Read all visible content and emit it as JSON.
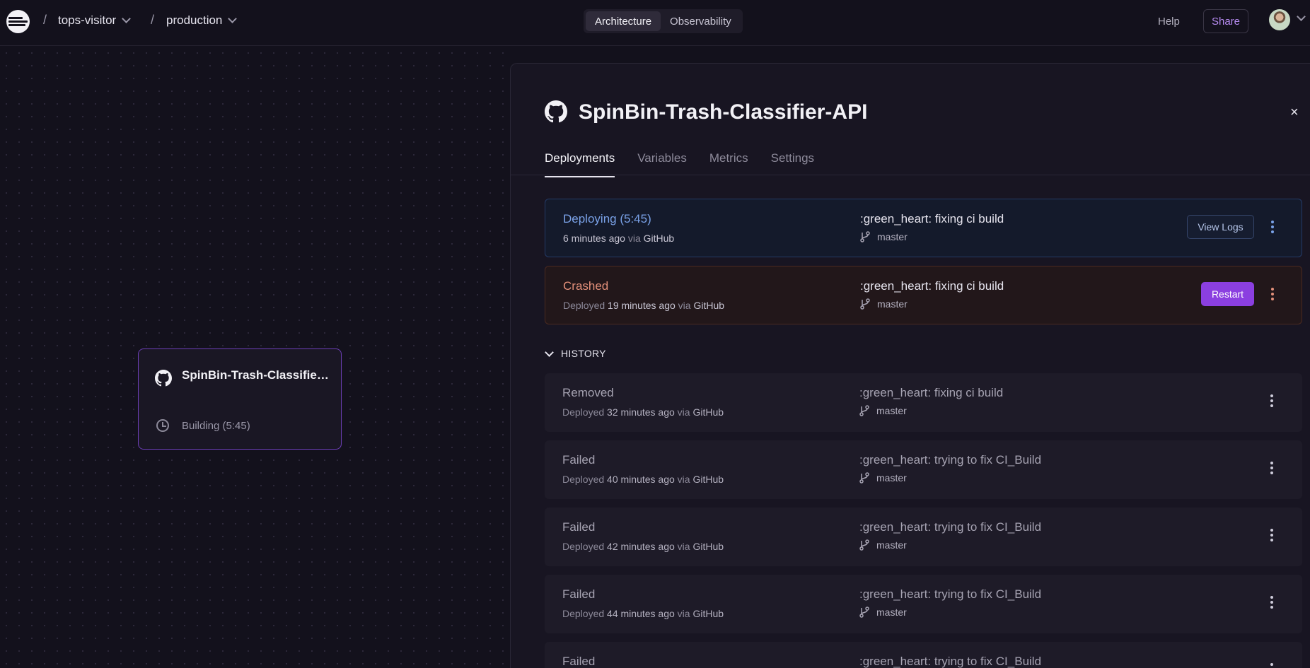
{
  "header": {
    "project": "tops-visitor",
    "environment": "production",
    "views": [
      "Architecture",
      "Observability"
    ],
    "active_view": "Architecture",
    "help_label": "Help",
    "share_label": "Share",
    "crumb_separator": "/"
  },
  "canvas": {
    "node": {
      "title": "SpinBin-Trash-Classifier-API",
      "status": "Building (5:45)",
      "icon": "github-icon"
    }
  },
  "panel": {
    "title": "SpinBin-Trash-Classifier-API",
    "close_label": "×",
    "tabs": [
      "Deployments",
      "Variables",
      "Metrics",
      "Settings"
    ],
    "active_tab": "Deployments",
    "history_label": "HISTORY",
    "via_label": "via",
    "deployed_label": "Deployed",
    "active_deployments": [
      {
        "status": "Deploying (5:45)",
        "time": "6 minutes ago",
        "source": "GitHub",
        "prefix": "",
        "message": ":green_heart: fixing ci build",
        "branch": "master",
        "action": "View Logs"
      },
      {
        "status": "Crashed",
        "time": "19 minutes ago",
        "source": "GitHub",
        "prefix": "Deployed",
        "message": ":green_heart: fixing ci build",
        "branch": "master",
        "action": "Restart"
      }
    ],
    "history": [
      {
        "status": "Removed",
        "time": "32 minutes ago",
        "source": "GitHub",
        "prefix": "Deployed",
        "message": ":green_heart: fixing ci build",
        "branch": "master"
      },
      {
        "status": "Failed",
        "time": "40 minutes ago",
        "source": "GitHub",
        "prefix": "Deployed",
        "message": ":green_heart: trying to fix CI_Build",
        "branch": "master"
      },
      {
        "status": "Failed",
        "time": "42 minutes ago",
        "source": "GitHub",
        "prefix": "Deployed",
        "message": ":green_heart: trying to fix CI_Build",
        "branch": "master"
      },
      {
        "status": "Failed",
        "time": "44 minutes ago",
        "source": "GitHub",
        "prefix": "Deployed",
        "message": ":green_heart: trying to fix CI_Build",
        "branch": "master"
      },
      {
        "status": "Failed",
        "time": "",
        "source": "",
        "prefix": "",
        "message": ":green_heart: trying to fix CI_Build",
        "branch": ""
      }
    ]
  },
  "colors": {
    "background": "#13111c",
    "accent": "#8b3fe0",
    "deploying": "#7aa2e8",
    "crashed": "#e3907a"
  }
}
